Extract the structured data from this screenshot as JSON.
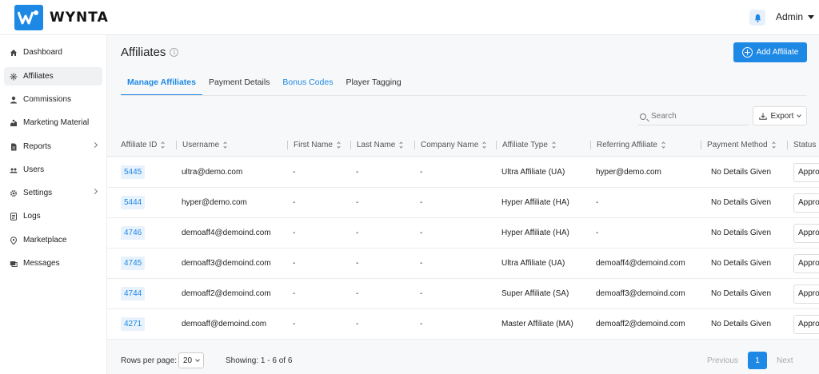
{
  "app": {
    "logo_text": "WYNTA",
    "user": "Admin"
  },
  "sidebar": {
    "items": [
      {
        "label": "Dashboard",
        "icon": "home-icon"
      },
      {
        "label": "Affiliates",
        "icon": "network-icon"
      },
      {
        "label": "Commissions",
        "icon": "money-icon"
      },
      {
        "label": "Marketing Material",
        "icon": "megaphone-icon"
      },
      {
        "label": "Reports",
        "icon": "report-icon"
      },
      {
        "label": "Users",
        "icon": "users-icon"
      },
      {
        "label": "Settings",
        "icon": "gear-icon"
      },
      {
        "label": "Logs",
        "icon": "logs-icon"
      },
      {
        "label": "Marketplace",
        "icon": "marketplace-icon"
      },
      {
        "label": "Messages",
        "icon": "messages-icon"
      }
    ]
  },
  "main": {
    "title": "Affiliates",
    "info_glyph": "i",
    "add_button": "Add Affiliate",
    "tabs": [
      {
        "label": "Manage Affiliates"
      },
      {
        "label": "Payment Details"
      },
      {
        "label": "Bonus Codes"
      },
      {
        "label": "Player Tagging"
      }
    ],
    "search_placeholder": "Search",
    "export_label": "Export"
  },
  "table": {
    "columns": [
      "Affiliate ID",
      "Username",
      "First Name",
      "Last Name",
      "Company Name",
      "Affiliate Type",
      "Referring Affiliate",
      "Payment Method",
      "Status"
    ],
    "rows": [
      {
        "id": "5445",
        "username": "ultra@demo.com",
        "first": "-",
        "last": "-",
        "company": "-",
        "type": "Ultra Affiliate (UA)",
        "referring": "hyper@demo.com",
        "payment": "No Details Given",
        "status": "Approved"
      },
      {
        "id": "5444",
        "username": "hyper@demo.com",
        "first": "-",
        "last": "-",
        "company": "-",
        "type": "Hyper Affiliate (HA)",
        "referring": "-",
        "payment": "No Details Given",
        "status": "Approved"
      },
      {
        "id": "4746",
        "username": "demoaff4@demoind.com",
        "first": "-",
        "last": "-",
        "company": "-",
        "type": "Hyper Affiliate (HA)",
        "referring": "-",
        "payment": "No Details Given",
        "status": "Approved"
      },
      {
        "id": "4745",
        "username": "demoaff3@demoind.com",
        "first": "-",
        "last": "-",
        "company": "-",
        "type": "Ultra Affiliate (UA)",
        "referring": "demoaff4@demoind.com",
        "payment": "No Details Given",
        "status": "Approved"
      },
      {
        "id": "4744",
        "username": "demoaff2@demoind.com",
        "first": "-",
        "last": "-",
        "company": "-",
        "type": "Super Affiliate (SA)",
        "referring": "demoaff3@demoind.com",
        "payment": "No Details Given",
        "status": "Approved"
      },
      {
        "id": "4271",
        "username": "demoaff@demoind.com",
        "first": "-",
        "last": "-",
        "company": "-",
        "type": "Master Affiliate (MA)",
        "referring": "demoaff2@demoind.com",
        "payment": "No Details Given",
        "status": "Approved"
      }
    ]
  },
  "footer": {
    "rows_per_page_label": "Rows per page:",
    "rows_per_page_value": "20",
    "showing": "Showing: 1 - 6 of 6",
    "previous": "Previous",
    "current_page": "1",
    "next": "Next"
  },
  "colors": {
    "accent": "#1e88e5",
    "badge_bg": "#e8f2fc"
  }
}
